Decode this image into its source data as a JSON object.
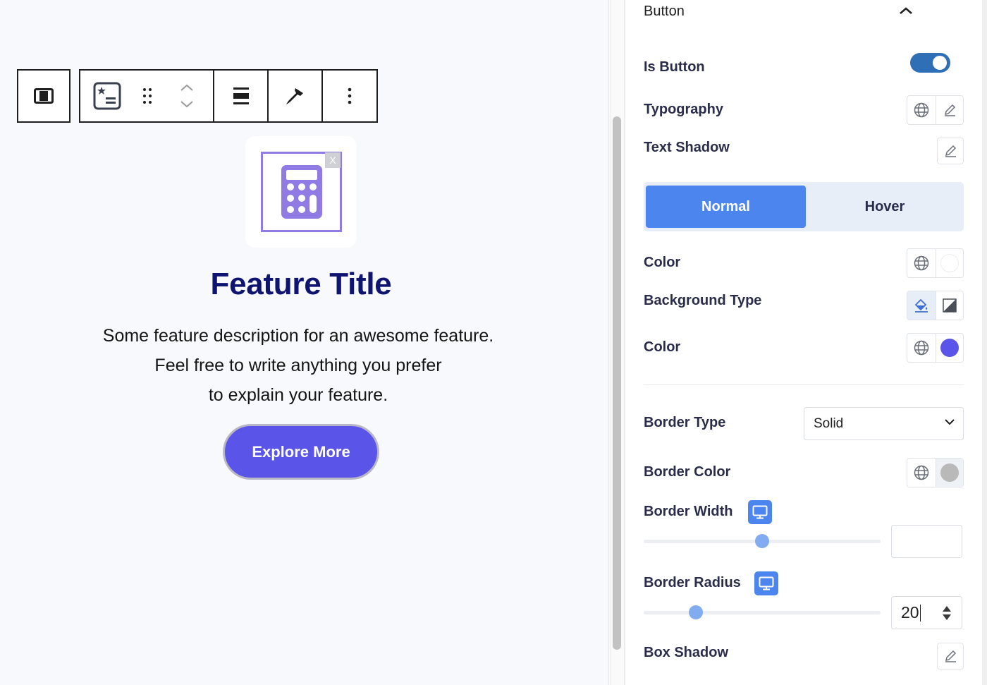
{
  "canvas": {
    "feature_icon_close": "X",
    "feature_title": "Feature Title",
    "description_lines": [
      "Some feature description for an awesome feature.",
      "Feel free to write anything you prefer",
      "to explain your feature."
    ],
    "button_label": "Explore More"
  },
  "inspector": {
    "section_title": "Button",
    "is_button": {
      "label": "Is Button",
      "checked": true
    },
    "typography_label": "Typography",
    "text_shadow_label": "Text Shadow",
    "tabs": {
      "normal": "Normal",
      "hover": "Hover",
      "active": "normal"
    },
    "color_label": "Color",
    "background_type_label": "Background Type",
    "background_color_label": "Color",
    "border_type": {
      "label": "Border Type",
      "value": "Solid"
    },
    "border_color_label": "Border Color",
    "border_width": {
      "label": "Border Width",
      "value": ""
    },
    "border_radius": {
      "label": "Border Radius",
      "value": "20"
    },
    "box_shadow_label": "Box Shadow"
  },
  "colors": {
    "accent": "#4d85ef",
    "button_bg": "#5a55e8",
    "title_color": "#0e1470",
    "text_color_swatch": "#ffffff",
    "background_color_swatch": "#5a55e8",
    "border_color_swatch": "#b9b9b9"
  },
  "icons": [
    "parent-block-icon",
    "feature-block-icon",
    "drag-handle-icon",
    "move-up-icon",
    "move-down-icon",
    "align-icon",
    "style-brush-icon",
    "more-options-icon",
    "calculator-icon",
    "chevron-up-icon",
    "globe-icon",
    "pencil-icon",
    "paint-bucket-icon",
    "gradient-icon",
    "chevron-down-icon",
    "desktop-icon"
  ]
}
